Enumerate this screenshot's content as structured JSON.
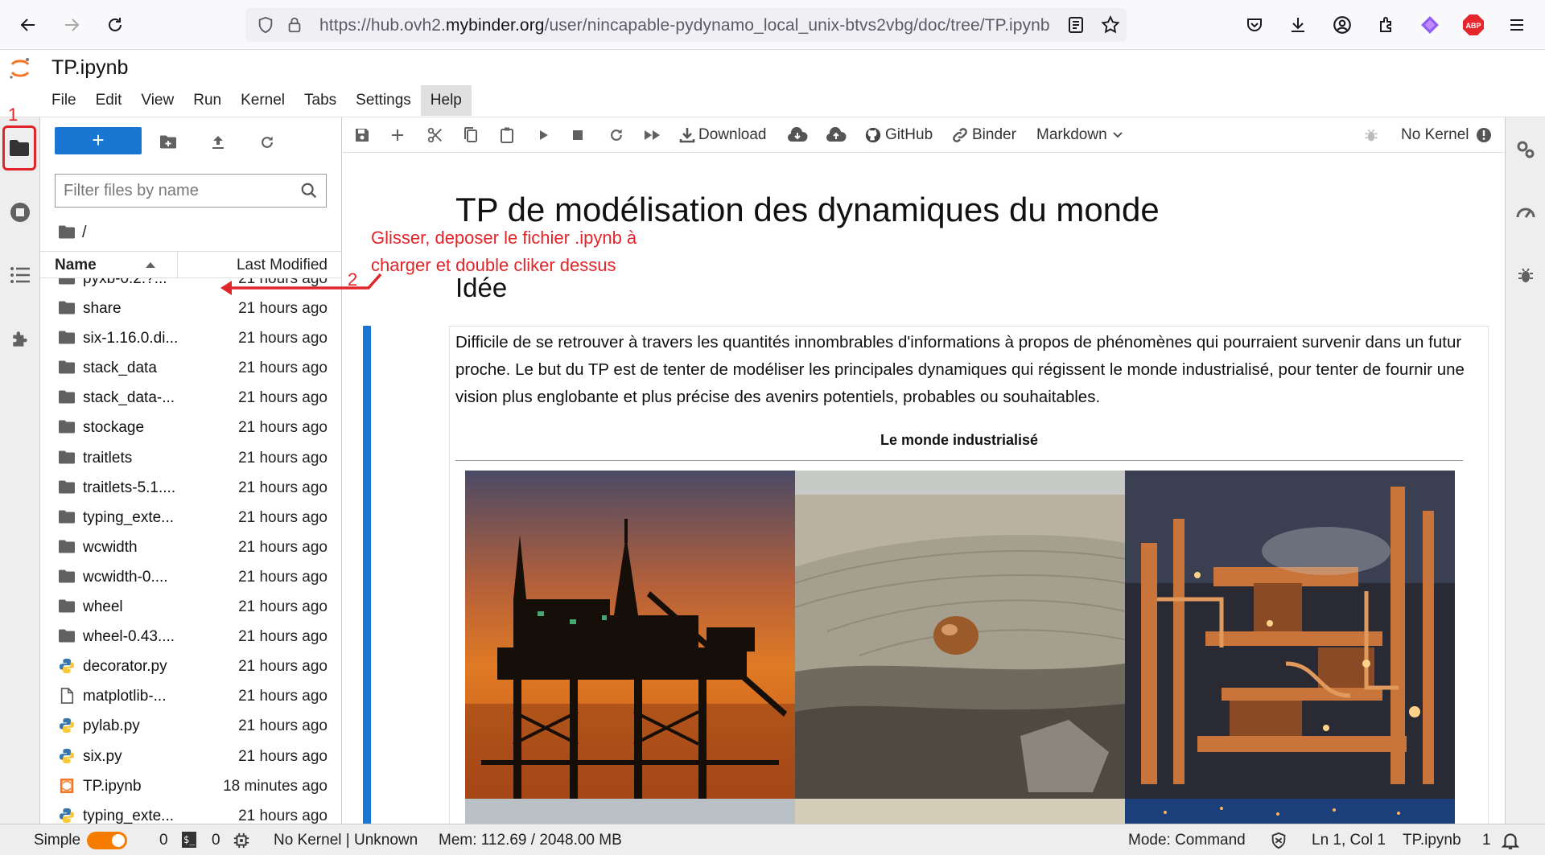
{
  "browser": {
    "url_prefix": "https://hub.ovh2.",
    "url_domain": "mybinder.org",
    "url_path": "/user/nincapable-pydynamo_local_unix-btvs2vbg/doc/tree/TP.ipynb",
    "abp_label": "ABP"
  },
  "notebook_title": "TP.ipynb",
  "menu": [
    "File",
    "Edit",
    "View",
    "Run",
    "Kernel",
    "Tabs",
    "Settings",
    "Help"
  ],
  "filebrowser": {
    "new_label": "+",
    "filter_placeholder": "Filter files by name",
    "breadcrumb": "/",
    "col_name": "Name",
    "col_modified": "Last Modified",
    "partial_row": {
      "name": "pyxb-0.2.?...",
      "modified": "21 hours ago"
    },
    "files": [
      {
        "name": "share",
        "modified": "21 hours ago",
        "type": "folder"
      },
      {
        "name": "six-1.16.0.di...",
        "modified": "21 hours ago",
        "type": "folder"
      },
      {
        "name": "stack_data",
        "modified": "21 hours ago",
        "type": "folder"
      },
      {
        "name": "stack_data-...",
        "modified": "21 hours ago",
        "type": "folder"
      },
      {
        "name": "stockage",
        "modified": "21 hours ago",
        "type": "folder"
      },
      {
        "name": "traitlets",
        "modified": "21 hours ago",
        "type": "folder"
      },
      {
        "name": "traitlets-5.1....",
        "modified": "21 hours ago",
        "type": "folder"
      },
      {
        "name": "typing_exte...",
        "modified": "21 hours ago",
        "type": "folder"
      },
      {
        "name": "wcwidth",
        "modified": "21 hours ago",
        "type": "folder"
      },
      {
        "name": "wcwidth-0....",
        "modified": "21 hours ago",
        "type": "folder"
      },
      {
        "name": "wheel",
        "modified": "21 hours ago",
        "type": "folder"
      },
      {
        "name": "wheel-0.43....",
        "modified": "21 hours ago",
        "type": "folder"
      },
      {
        "name": "decorator.py",
        "modified": "21 hours ago",
        "type": "python"
      },
      {
        "name": "matplotlib-...",
        "modified": "21 hours ago",
        "type": "file"
      },
      {
        "name": "pylab.py",
        "modified": "21 hours ago",
        "type": "python"
      },
      {
        "name": "six.py",
        "modified": "21 hours ago",
        "type": "python"
      },
      {
        "name": "TP.ipynb",
        "modified": "18 minutes ago",
        "type": "notebook"
      },
      {
        "name": "typing_exte...",
        "modified": "21 hours ago",
        "type": "python"
      }
    ]
  },
  "toolbar": {
    "download": "Download",
    "github": "GitHub",
    "binder": "Binder",
    "cell_type": "Markdown",
    "kernel": "No Kernel"
  },
  "notebook": {
    "h1": "TP de modélisation des dynamiques du monde",
    "h2": "Idée",
    "paragraph": "Difficile de se retrouver à travers les quantités innombrables d'informations à propos de phénomènes qui pourraient survenir dans un futur proche. Le but du TP est de tenter de modéliser les principales dynamiques qui régissent le monde industrialisé, pour tenter de fournir une vision plus englobante et plus précise des avenirs potentiels, probables ou souhaitables.",
    "caption": "Le monde industrialisé"
  },
  "annotations": {
    "num1": "1",
    "num2": "2",
    "instruction_line1": "Glisser, deposer le fichier .ipynb à",
    "instruction_line2": "charger et double cliker dessus",
    "color": "#e0262a"
  },
  "status": {
    "mode_simple": "Simple",
    "count_a": "0",
    "terminal_badge": "$_",
    "count_b": "0",
    "kernel_status": "No Kernel | Unknown",
    "mem": "Mem: 112.69 / 2048.00 MB",
    "mode": "Mode: Command",
    "position": "Ln 1, Col 1",
    "filename": "TP.ipynb",
    "notifications": "1"
  },
  "colors": {
    "accent": "#1976d2",
    "toggle": "#f57c00",
    "folder": "#616161",
    "annotation": "#e0262a"
  }
}
